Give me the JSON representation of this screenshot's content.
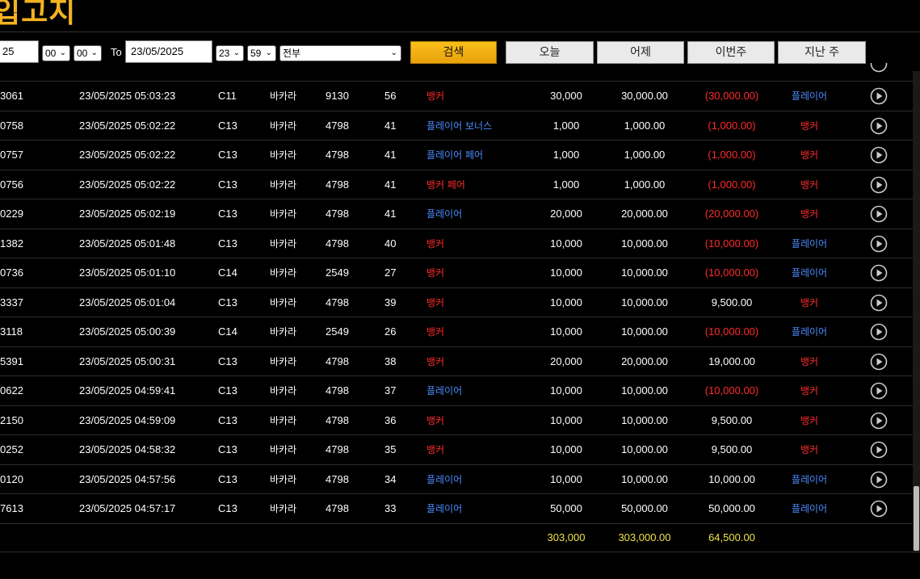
{
  "title": "입고지",
  "filters": {
    "from_date": "25",
    "from_hour": "00",
    "from_min": "00",
    "to_label": "To",
    "to_date": "23/05/2025",
    "to_hour": "23",
    "to_min": "59",
    "game_filter": "전부",
    "search_label": "검색",
    "today_label": "오늘",
    "yesterday_label": "어제",
    "this_week_label": "이번주",
    "last_week_label": "지난 주"
  },
  "rows": [
    {
      "id": "3061",
      "datetime": "23/05/2025 05:03:23",
      "table": "C11",
      "game": "바카라",
      "shoe": "9130",
      "round": "56",
      "bet": "뱅커",
      "amount": "30,000",
      "valid": "30,000.00",
      "winloss": "(30,000.00)",
      "result": "플레이어"
    },
    {
      "id": "0758",
      "datetime": "23/05/2025 05:02:22",
      "table": "C13",
      "game": "바카라",
      "shoe": "4798",
      "round": "41",
      "bet": "플레이어 보너스",
      "amount": "1,000",
      "valid": "1,000.00",
      "winloss": "(1,000.00)",
      "result": "뱅커"
    },
    {
      "id": "0757",
      "datetime": "23/05/2025 05:02:22",
      "table": "C13",
      "game": "바카라",
      "shoe": "4798",
      "round": "41",
      "bet": "플레이어 페어",
      "amount": "1,000",
      "valid": "1,000.00",
      "winloss": "(1,000.00)",
      "result": "뱅커"
    },
    {
      "id": "0756",
      "datetime": "23/05/2025 05:02:22",
      "table": "C13",
      "game": "바카라",
      "shoe": "4798",
      "round": "41",
      "bet": "뱅커 페어",
      "amount": "1,000",
      "valid": "1,000.00",
      "winloss": "(1,000.00)",
      "result": "뱅커"
    },
    {
      "id": "0229",
      "datetime": "23/05/2025 05:02:19",
      "table": "C13",
      "game": "바카라",
      "shoe": "4798",
      "round": "41",
      "bet": "플레이어",
      "amount": "20,000",
      "valid": "20,000.00",
      "winloss": "(20,000.00)",
      "result": "뱅커"
    },
    {
      "id": "1382",
      "datetime": "23/05/2025 05:01:48",
      "table": "C13",
      "game": "바카라",
      "shoe": "4798",
      "round": "40",
      "bet": "뱅커",
      "amount": "10,000",
      "valid": "10,000.00",
      "winloss": "(10,000.00)",
      "result": "플레이어"
    },
    {
      "id": "0736",
      "datetime": "23/05/2025 05:01:10",
      "table": "C14",
      "game": "바카라",
      "shoe": "2549",
      "round": "27",
      "bet": "뱅커",
      "amount": "10,000",
      "valid": "10,000.00",
      "winloss": "(10,000.00)",
      "result": "플레이어"
    },
    {
      "id": "3337",
      "datetime": "23/05/2025 05:01:04",
      "table": "C13",
      "game": "바카라",
      "shoe": "4798",
      "round": "39",
      "bet": "뱅커",
      "amount": "10,000",
      "valid": "10,000.00",
      "winloss": "9,500.00",
      "result": "뱅커"
    },
    {
      "id": "3118",
      "datetime": "23/05/2025 05:00:39",
      "table": "C14",
      "game": "바카라",
      "shoe": "2549",
      "round": "26",
      "bet": "뱅커",
      "amount": "10,000",
      "valid": "10,000.00",
      "winloss": "(10,000.00)",
      "result": "플레이어"
    },
    {
      "id": "5391",
      "datetime": "23/05/2025 05:00:31",
      "table": "C13",
      "game": "바카라",
      "shoe": "4798",
      "round": "38",
      "bet": "뱅커",
      "amount": "20,000",
      "valid": "20,000.00",
      "winloss": "19,000.00",
      "result": "뱅커"
    },
    {
      "id": "0622",
      "datetime": "23/05/2025 04:59:41",
      "table": "C13",
      "game": "바카라",
      "shoe": "4798",
      "round": "37",
      "bet": "플레이어",
      "amount": "10,000",
      "valid": "10,000.00",
      "winloss": "(10,000.00)",
      "result": "뱅커"
    },
    {
      "id": "2150",
      "datetime": "23/05/2025 04:59:09",
      "table": "C13",
      "game": "바카라",
      "shoe": "4798",
      "round": "36",
      "bet": "뱅커",
      "amount": "10,000",
      "valid": "10,000.00",
      "winloss": "9,500.00",
      "result": "뱅커"
    },
    {
      "id": "0252",
      "datetime": "23/05/2025 04:58:32",
      "table": "C13",
      "game": "바카라",
      "shoe": "4798",
      "round": "35",
      "bet": "뱅커",
      "amount": "10,000",
      "valid": "10,000.00",
      "winloss": "9,500.00",
      "result": "뱅커"
    },
    {
      "id": "0120",
      "datetime": "23/05/2025 04:57:56",
      "table": "C13",
      "game": "바카라",
      "shoe": "4798",
      "round": "34",
      "bet": "플레이어",
      "amount": "10,000",
      "valid": "10,000.00",
      "winloss": "10,000.00",
      "result": "플레이어"
    },
    {
      "id": "7613",
      "datetime": "23/05/2025 04:57:17",
      "table": "C13",
      "game": "바카라",
      "shoe": "4798",
      "round": "33",
      "bet": "플레이어",
      "amount": "50,000",
      "valid": "50,000.00",
      "winloss": "50,000.00",
      "result": "플레이어"
    }
  ],
  "totals": {
    "amount": "303,000",
    "valid": "303,000.00",
    "winloss": "64,500.00"
  },
  "colors": {
    "banker": "#ff2a2a",
    "player": "#4a8cff",
    "negative": "#ff2a2a",
    "total": "#f0e34a",
    "accent": "#f4b222"
  },
  "icons": {
    "row_action": "play-circle-icon"
  }
}
